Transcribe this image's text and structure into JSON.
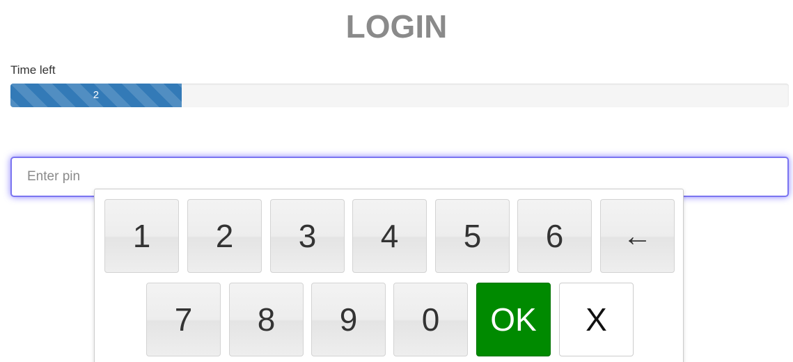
{
  "header": {
    "title": "LOGIN"
  },
  "timer": {
    "label": "Time left",
    "value_text": "2",
    "fraction": 0.22,
    "color": "#337ab7"
  },
  "pin": {
    "placeholder": "Enter pin",
    "value": ""
  },
  "keypad": {
    "keys": {
      "k1": "1",
      "k2": "2",
      "k3": "3",
      "k4": "4",
      "k5": "5",
      "k6": "6",
      "k7": "7",
      "k8": "8",
      "k9": "9",
      "k0": "0",
      "backspace": "←",
      "ok": "OK",
      "close": "X"
    },
    "ok_color": "#008a00"
  }
}
